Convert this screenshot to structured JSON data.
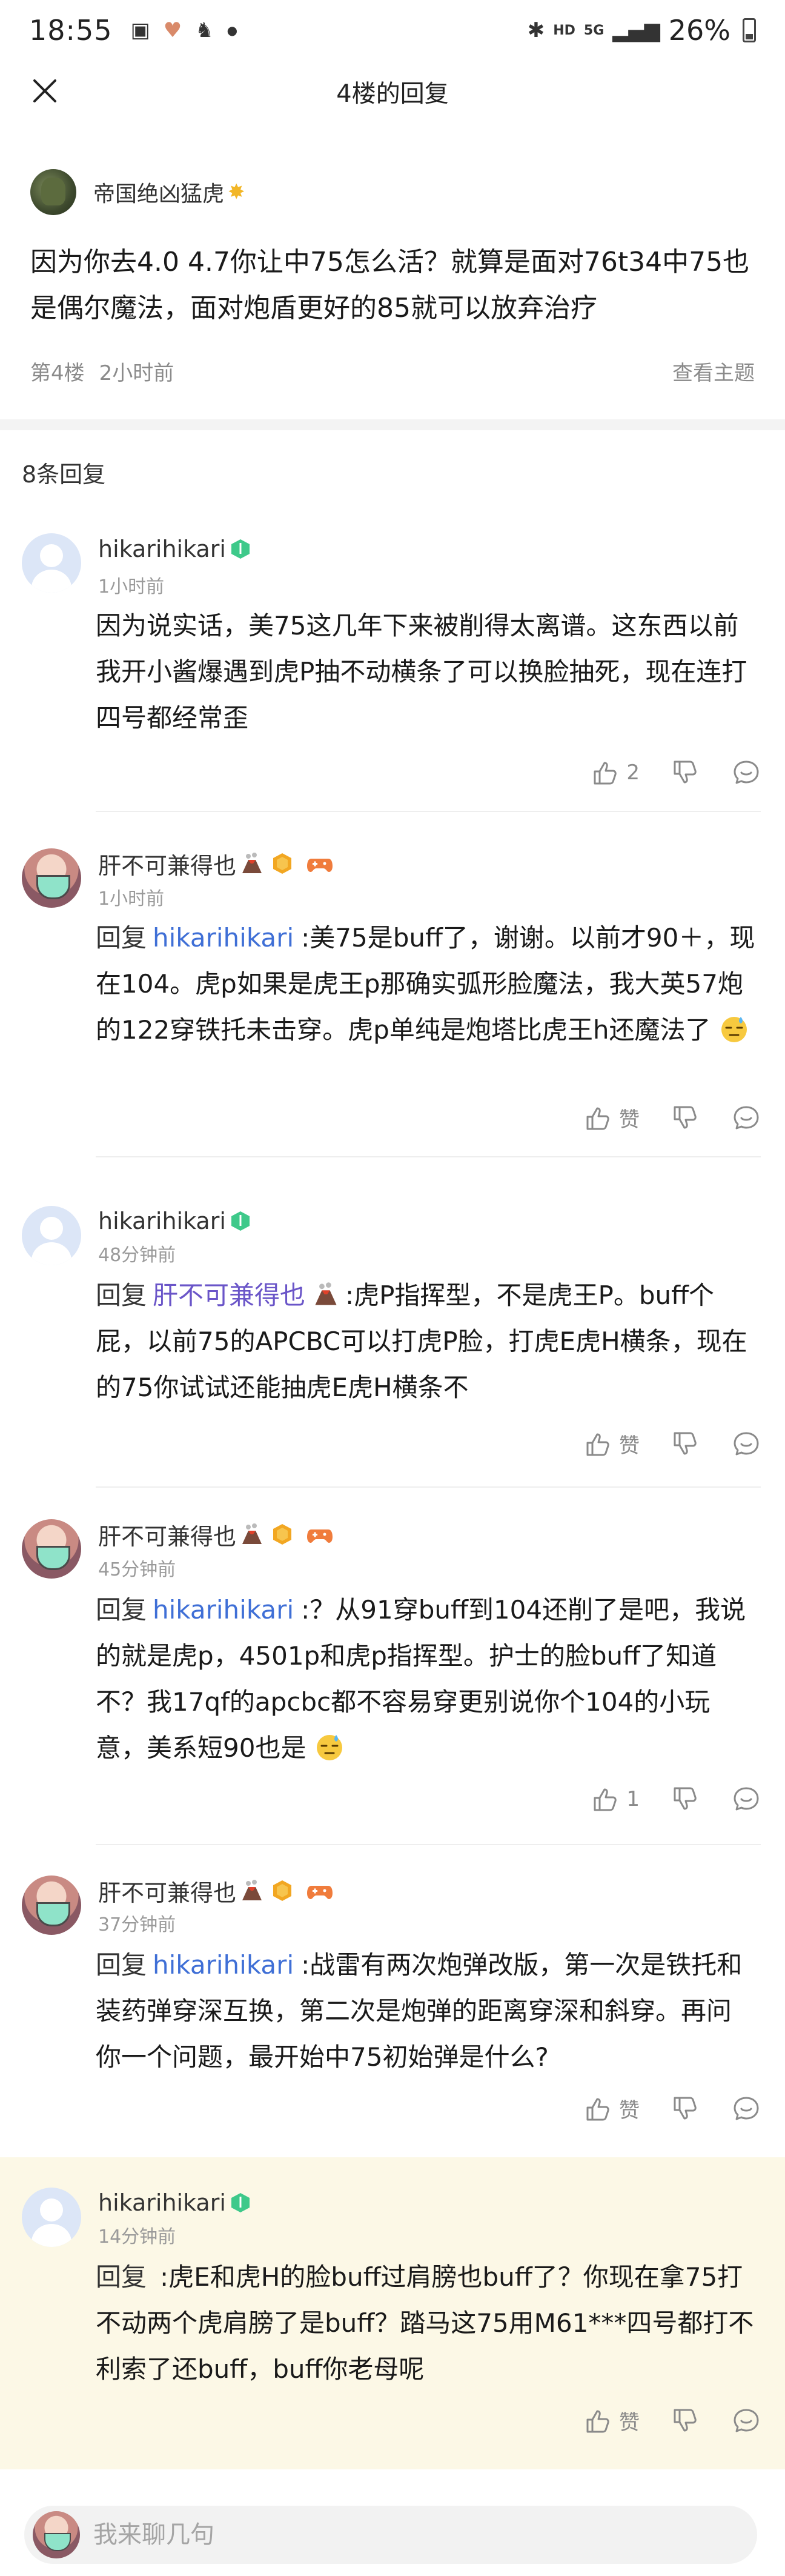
{
  "status_bar": {
    "time": "18:55",
    "network": "HD",
    "network2": "5G",
    "battery": "26%"
  },
  "nav": {
    "title": "4楼的回复"
  },
  "main_post": {
    "author": "帝国绝凶猛虎",
    "content": "因为你去4.0 4.7你让中75怎么活？就算是面对76t34中75也是偶尔魔法，面对炮盾更好的85就可以放弃治疗",
    "floor": "第4楼",
    "time": "2小时前",
    "view_topic": "查看主题"
  },
  "reply_count": "8条回复",
  "replies": [
    {
      "author": "hikarihikari",
      "time": "1小时前",
      "text": "因为说实话，美75这几年下来被削得太离谱。这东西以前我开小酱爆遇到虎P抽不动横条了可以换脸抽死，现在连打四号都经常歪",
      "like_label": "2"
    },
    {
      "author": "肝不可兼得也",
      "time": "1小时前",
      "reply_prefix": "回复",
      "mention": "hikarihikari",
      "text": ":美75是buff了，谢谢。以前才90＋，现在104。虎p如果是虎王p那确实弧形脸魔法，我大英57炮的122穿铁托未击穿。虎p单纯是炮塔比虎王h还魔法了",
      "like_label": "赞"
    },
    {
      "author": "hikarihikari",
      "time": "48分钟前",
      "reply_prefix": "回复",
      "mention": "肝不可兼得也",
      "text": ":虎P指挥型，不是虎王P。buff个屁，以前75的APCBC可以打虎P脸，打虎E虎H横条，现在的75你试试还能抽虎E虎H横条不",
      "like_label": "赞"
    },
    {
      "author": "肝不可兼得也",
      "time": "45分钟前",
      "reply_prefix": "回复",
      "mention": "hikarihikari",
      "text": ":？从91穿buff到104还削了是吧，我说的就是虎p，4501p和虎p指挥型。护士的脸buff了知道不？我17qf的apcbc都不容易穿更别说你个104的小玩意，美系短90也是",
      "like_label": "1"
    },
    {
      "author": "肝不可兼得也",
      "time": "37分钟前",
      "reply_prefix": "回复",
      "mention": "hikarihikari",
      "text": ":战雷有两次炮弹改版，第一次是铁托和装药弹穿深互换，第二次是炮弹的距离穿深和斜穿。再问你一个问题，最开始中75初始弹是什么?",
      "like_label": "赞"
    },
    {
      "author": "hikarihikari",
      "time": "14分钟前",
      "reply_prefix": "回复",
      "text": ":虎E和虎H的脸buff过肩膀也buff了？你现在拿75打不动两个虎肩膀了是buff？踏马这75用M61***四号都打不利索了还buff，buff你老母呢",
      "like_label": "赞"
    }
  ],
  "composer": {
    "placeholder": "我来聊几句"
  },
  "colors": {
    "mention_blue": "#3f6fd6",
    "mention_purple": "#6a55c8",
    "highlight_bg": "#fcf8e6",
    "gem_green": "#3ec98a"
  }
}
